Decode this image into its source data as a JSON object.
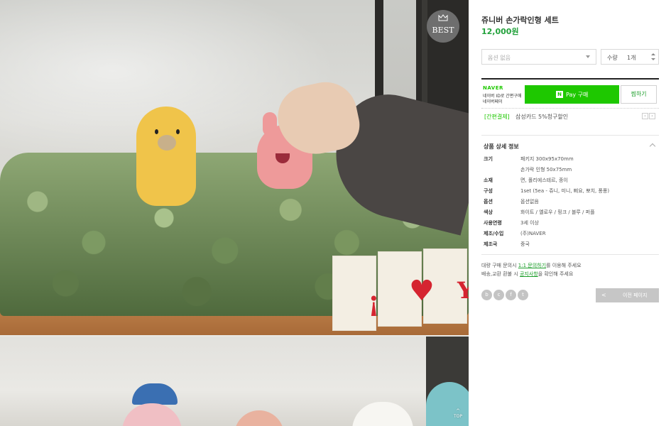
{
  "badge": {
    "best": "BEST",
    "icon": "crown-icon"
  },
  "top_button": {
    "label": "TOP",
    "icon": "arrow-up-icon"
  },
  "product": {
    "title": "쥬니버 손가락인형 세트",
    "price": "12,000원"
  },
  "option": {
    "placeholder": "옵션 없음"
  },
  "quantity": {
    "label": "수량",
    "value": "1개"
  },
  "npay": {
    "logo": "NAVER",
    "sub1": "네이버 ID로 간편구매",
    "sub2": "네이버페이",
    "pay_icon": "N",
    "pay_label": "Pay 구매",
    "cart_label": "찜하기",
    "promo_tag": "[간편결제]",
    "promo_text": "삼성카드 5%청구할인",
    "prev": "‹",
    "next": "›"
  },
  "detail": {
    "header": "상품 상세 정보",
    "rows": [
      {
        "k": "크기",
        "v": "패키지 300x95x70mm"
      },
      {
        "k": "",
        "v": "손가락 인형 50x75mm"
      },
      {
        "k": "소재",
        "v": "면, 폴리에스테르, 종이"
      },
      {
        "k": "구성",
        "v": "1set (5ea - 쥬니, 미니, 삐요, 뽀치, 퐁퐁)"
      },
      {
        "k": "옵션",
        "v": "옵션없음"
      },
      {
        "k": "색상",
        "v": "화이트 / 옐로우 / 핑크 / 블루 / 퍼플"
      },
      {
        "k": "사용연령",
        "v": "3세 이상"
      },
      {
        "k": "제조/수입",
        "v": "(주)NAVER"
      },
      {
        "k": "제조국",
        "v": "중국"
      }
    ]
  },
  "notice": {
    "line1_pre": "대량 구매 문의시 ",
    "line1_link": "1:1 문의하기",
    "line1_post": "를 이용해 주세요",
    "line2_pre": "배송,교환 환불 시 ",
    "line2_link": "공지사항",
    "line2_post": "을 확인해 주세요"
  },
  "share": {
    "icons": [
      "blog-icon",
      "cafe-icon",
      "facebook-icon",
      "twitter-icon"
    ],
    "glyphs": [
      "b",
      "c",
      "f",
      "t"
    ]
  },
  "prev_page": {
    "arrow": "<",
    "label": "이전 페이지"
  },
  "colors": {
    "accent": "#1ec800",
    "price": "#23a23c",
    "link": "#1a9d28"
  }
}
